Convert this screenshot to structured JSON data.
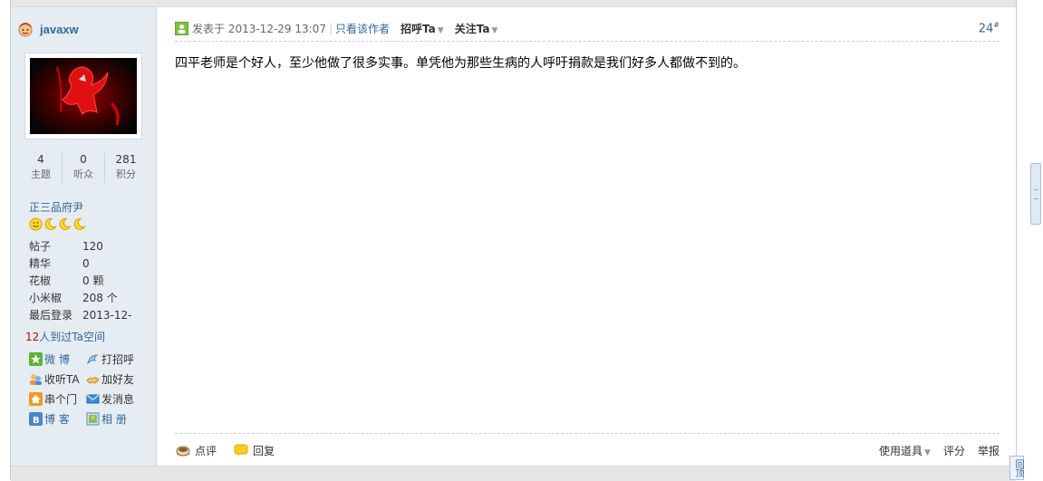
{
  "user": {
    "name": "javaxw",
    "rank": "正三品府尹",
    "stats": [
      {
        "value": "4",
        "label": "主题"
      },
      {
        "value": "0",
        "label": "听众"
      },
      {
        "value": "281",
        "label": "积分"
      }
    ],
    "info": [
      {
        "key": "帖子",
        "value": "120"
      },
      {
        "key": "精华",
        "value": "0"
      },
      {
        "key": "花椒",
        "value": "0 颗"
      },
      {
        "key": "小米椒",
        "value": "208 个"
      },
      {
        "key": "最后登录",
        "value": "2013-12-"
      }
    ],
    "visitors_count": "12",
    "visitors_text": "人到过Ta空间",
    "actions": [
      {
        "label": "微 博",
        "icon": "weibo-star-icon"
      },
      {
        "label": "打招呼",
        "icon": "poke-icon"
      },
      {
        "label": "收听TA",
        "icon": "follow-icon"
      },
      {
        "label": "加好友",
        "icon": "add-friend-icon"
      },
      {
        "label": "串个门",
        "icon": "home-icon"
      },
      {
        "label": "发消息",
        "icon": "mail-icon"
      },
      {
        "label": "博 客",
        "icon": "blog-icon"
      },
      {
        "label": "相 册",
        "icon": "album-icon"
      }
    ]
  },
  "post": {
    "posted_at": "发表于 2013-12-29 13:07",
    "author_only": "只看该作者",
    "greet": "招呼Ta",
    "follow": "关注Ta",
    "floor": "24",
    "floor_mark": "#",
    "content": "四平老师是个好人，至少他做了很多实事。单凭他为那些生病的人呼吁捐款是我们好多人都做不到的。"
  },
  "footer": {
    "comment": "点评",
    "reply": "回复",
    "use_tool": "使用道具",
    "rate": "评分",
    "report": "举报"
  },
  "back_to_top": "回顶"
}
